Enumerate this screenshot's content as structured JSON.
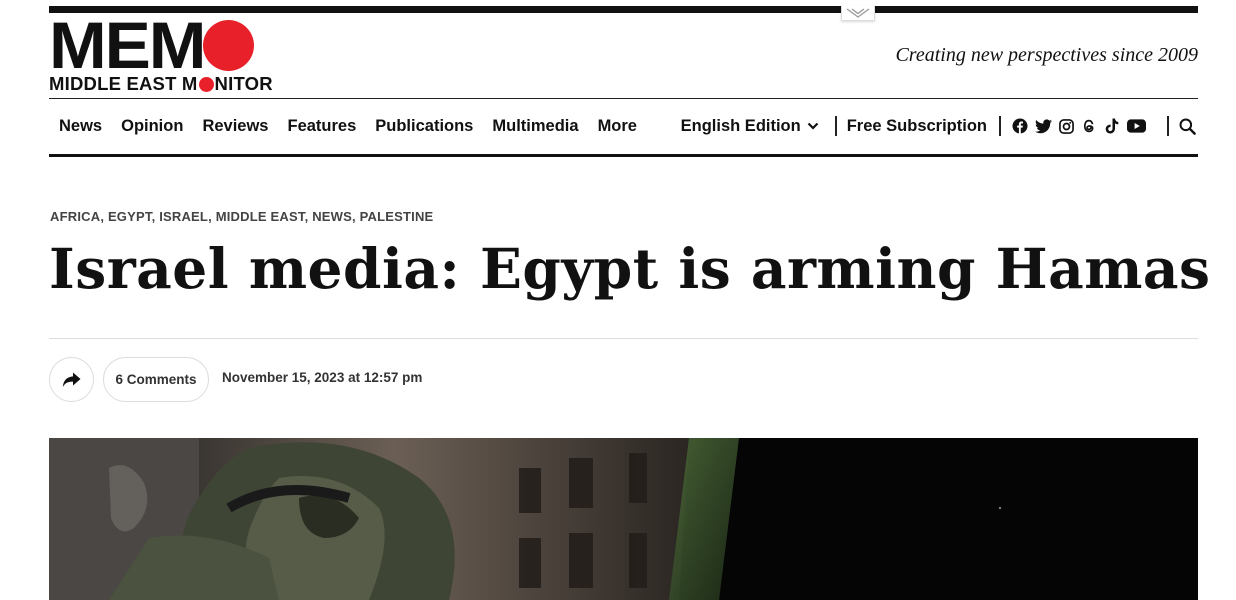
{
  "header": {
    "logo_main": "MEM",
    "logo_sub_before": "MIDDLE EAST M",
    "logo_sub_after": "NITOR",
    "tagline": "Creating new perspectives since 2009"
  },
  "nav": {
    "items": [
      {
        "label": "News"
      },
      {
        "label": "Opinion"
      },
      {
        "label": "Reviews"
      },
      {
        "label": "Features"
      },
      {
        "label": "Publications"
      },
      {
        "label": "Multimedia"
      },
      {
        "label": "More"
      }
    ],
    "edition": "English Edition",
    "free_subscription": "Free Subscription",
    "socials": [
      "facebook-icon",
      "twitter-icon",
      "instagram-icon",
      "threads-icon",
      "tiktok-icon",
      "youtube-icon"
    ]
  },
  "article": {
    "categories": [
      "AFRICA",
      "EGYPT",
      "ISRAEL",
      "MIDDLE EAST",
      "NEWS",
      "PALESTINE"
    ],
    "title": "Israel media: Egypt is arming Hamas",
    "comments": "6 Comments",
    "date": "November 15, 2023 at 12:57 pm"
  },
  "colors": {
    "brand_red": "#e8202a",
    "text": "#111111"
  }
}
